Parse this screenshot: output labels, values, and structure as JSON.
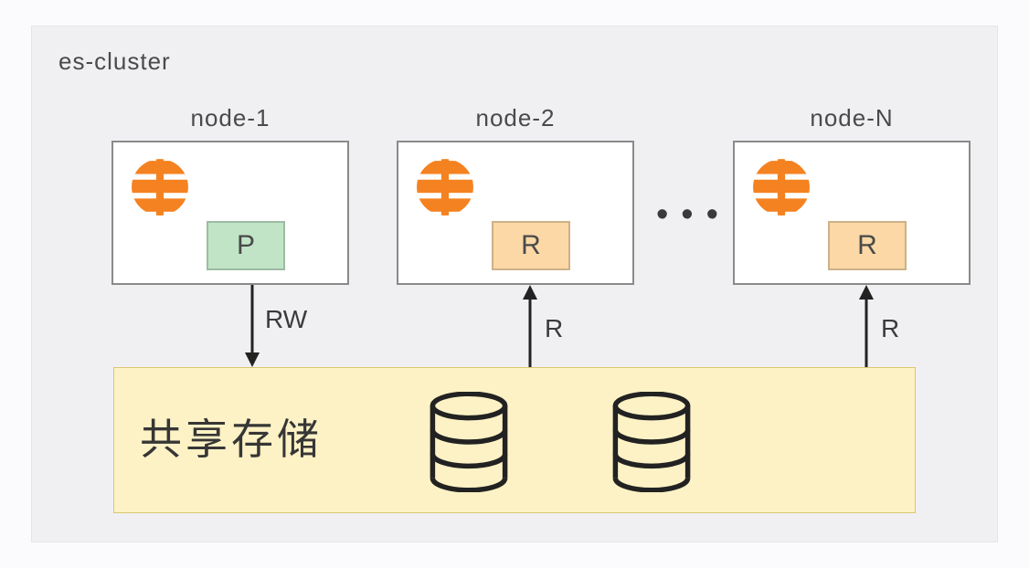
{
  "cluster_label": "es-cluster",
  "nodes": [
    {
      "label": "node-1",
      "shard": "P",
      "arrow": "RW"
    },
    {
      "label": "node-2",
      "shard": "R",
      "arrow": "R"
    },
    {
      "label": "node-N",
      "shard": "R",
      "arrow": "R"
    }
  ],
  "ellipsis": "•••",
  "storage_label": "共享存储"
}
